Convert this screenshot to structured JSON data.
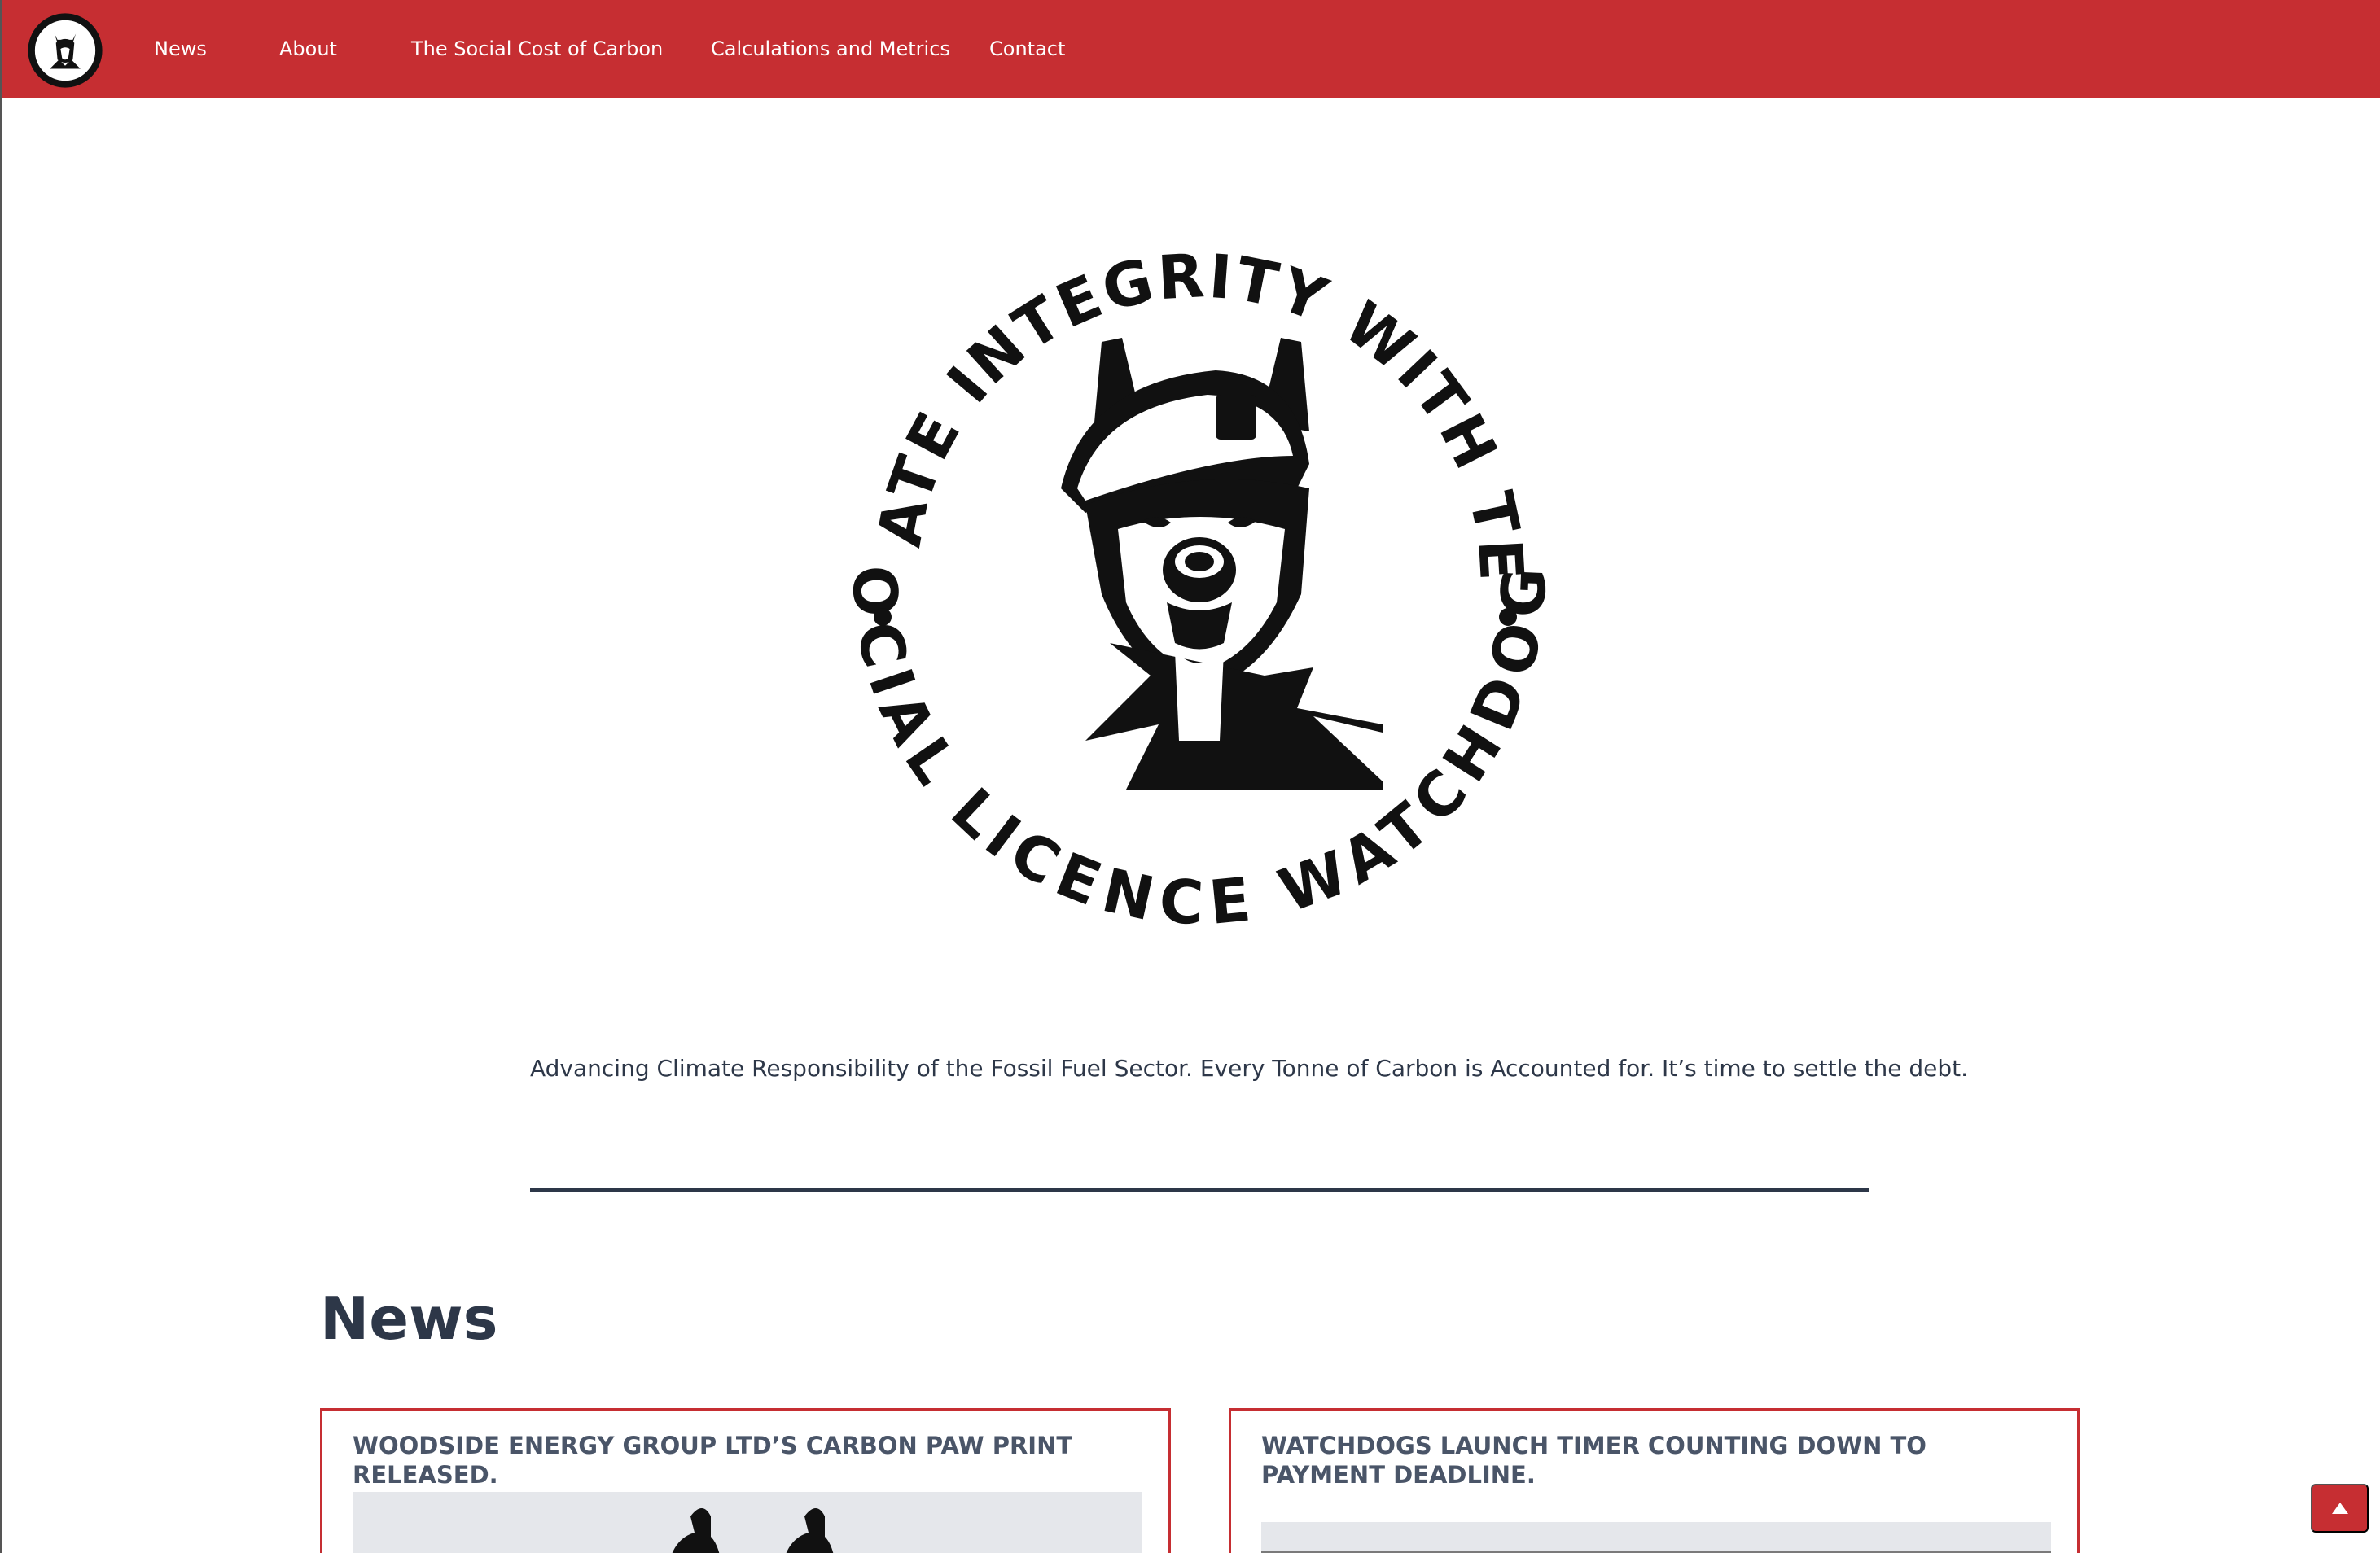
{
  "nav": {
    "items": [
      {
        "label": "News"
      },
      {
        "label": "About"
      },
      {
        "label": "The Social Cost of Carbon"
      },
      {
        "label": "Calculations and Metrics"
      },
      {
        "label": "Contact"
      }
    ]
  },
  "logo": {
    "top_text": "CLIMATE INTEGRITY WITH TEETH",
    "bottom_text": "SOCIAL LICENCE WATCHDOGS"
  },
  "hero": {
    "tagline": "Advancing Climate Responsibility of the Fossil Fuel Sector. Every Tonne of Carbon is Accounted for. It’s time to settle the debt."
  },
  "news": {
    "heading": "News",
    "cards": [
      {
        "title": "WOODSIDE ENERGY GROUP LTD’S CARBON PAW PRINT RELEASED."
      },
      {
        "title": "WATCHDOGS LAUNCH TIMER COUNTING DOWN TO PAYMENT DEADLINE."
      }
    ]
  },
  "colors": {
    "brand_red": "#c62e32",
    "text_dark": "#2d3748"
  },
  "icons": {
    "scroll_top": "caret-up-icon"
  }
}
